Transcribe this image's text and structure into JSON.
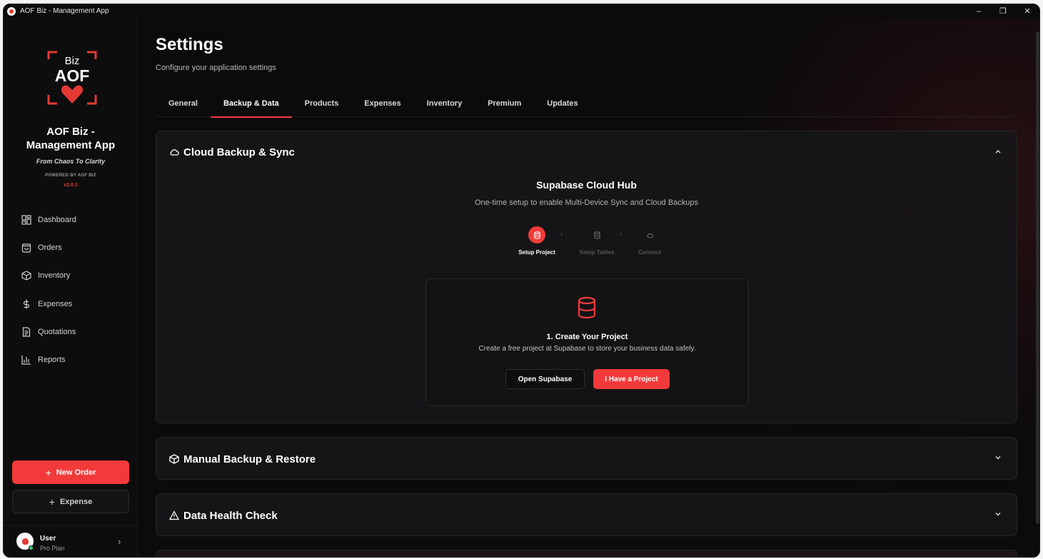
{
  "window": {
    "title": "AOF Biz - Management App",
    "minimize": "–",
    "maximize": "❐",
    "close": "✕"
  },
  "sidebar": {
    "logo_text_top": "Biz",
    "logo_text_main": "AOF",
    "brand_title_1": "AOF Biz -",
    "brand_title_2": "Management App",
    "tagline": "From Chaos To Clarity",
    "powered": "POWERED BY AOF BIZ",
    "version": "v2.0.1",
    "items": [
      {
        "label": "Dashboard",
        "icon": "grid-icon"
      },
      {
        "label": "Orders",
        "icon": "bag-icon"
      },
      {
        "label": "Inventory",
        "icon": "box-icon"
      },
      {
        "label": "Expenses",
        "icon": "dollar-icon"
      },
      {
        "label": "Quotations",
        "icon": "document-icon"
      },
      {
        "label": "Reports",
        "icon": "bar-chart-icon"
      }
    ],
    "new_order": "New Order",
    "expense": "Expense",
    "plus": "+",
    "user": {
      "name": "User",
      "plan": "Pro Plan",
      "chevron": "›"
    }
  },
  "main": {
    "title": "Settings",
    "subtitle": "Configure your application settings",
    "tabs": [
      {
        "label": "General"
      },
      {
        "label": "Backup & Data",
        "active": true
      },
      {
        "label": "Products"
      },
      {
        "label": "Expenses"
      },
      {
        "label": "Inventory"
      },
      {
        "label": "Premium"
      },
      {
        "label": "Updates"
      }
    ],
    "cloud": {
      "title": "Cloud Backup & Sync",
      "hub_title": "Supabase Cloud Hub",
      "hub_sub": "One-time setup to enable Multi-Device Sync and Cloud Backups",
      "steps": [
        {
          "label": "Setup Project"
        },
        {
          "label": "Setup Tables"
        },
        {
          "label": "Connect"
        }
      ],
      "step_arrow": "›",
      "card_title": "1. Create Your Project",
      "card_desc": "Create a free project at Supabase to store your business data safely.",
      "open_btn": "Open Supabase",
      "have_btn": "I Have a Project"
    },
    "manual": {
      "title": "Manual Backup & Restore"
    },
    "health": {
      "title": "Data Health Check"
    }
  },
  "colors": {
    "accent": "#f23a3a",
    "bg": "#0b0b0c",
    "panel": "#161618"
  }
}
